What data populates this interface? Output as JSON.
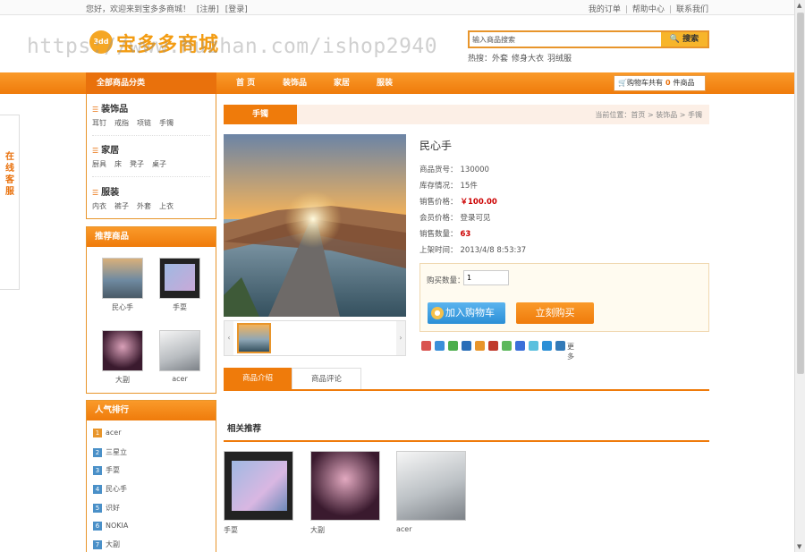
{
  "topbar": {
    "welcome": "您好，欢迎来到宝多多商城！",
    "register": "[注册]",
    "login": "[登录]",
    "links": [
      "我的订单",
      "帮助中心",
      "联系我们"
    ]
  },
  "logo": {
    "badge": "3dd",
    "text": "宝多多商城"
  },
  "watermark": "https://www.huzhan.com/ishop2940",
  "search": {
    "placeholder": "输入商品搜索",
    "button": "搜索"
  },
  "hot": {
    "label": "热搜：",
    "terms": [
      "外套",
      "修身大衣",
      "羽绒服"
    ]
  },
  "nav": {
    "all_categories": "全部商品分类",
    "items": [
      "首 页",
      "装饰品",
      "家居",
      "服装"
    ],
    "cart_prefix": "购物车共有",
    "cart_count": "0",
    "cart_suffix": "件商品"
  },
  "service_tab": "在线客服",
  "categories": [
    {
      "name": "装饰品",
      "subs": [
        "耳钉",
        "戒指",
        "项链",
        "手镯"
      ]
    },
    {
      "name": "家居",
      "subs": [
        "厨具",
        "床",
        "凳子",
        "桌子"
      ]
    },
    {
      "name": "服装",
      "subs": [
        "内衣",
        "裤子",
        "外套",
        "上衣"
      ]
    }
  ],
  "recommended": {
    "title": "推荐商品",
    "items": [
      {
        "label": "民心手",
        "icon": "landscape-photo"
      },
      {
        "label": "手耍",
        "icon": "tablet-photo"
      },
      {
        "label": "大副",
        "icon": "portrait-photo"
      },
      {
        "label": "acer",
        "icon": "snow-tree-photo"
      }
    ]
  },
  "popular": {
    "title": "人气排行",
    "items": [
      {
        "rank": "1",
        "label": "acer"
      },
      {
        "rank": "2",
        "label": "三星立"
      },
      {
        "rank": "3",
        "label": "手耍"
      },
      {
        "rank": "4",
        "label": "民心手"
      },
      {
        "rank": "5",
        "label": "识好"
      },
      {
        "rank": "6",
        "label": "NOKIA"
      },
      {
        "rank": "7",
        "label": "大副"
      }
    ]
  },
  "breadcrumb": {
    "tab": "手镯",
    "text": "当前位置：首页 > 装饰品 > 手镯"
  },
  "product": {
    "name": "民心手",
    "attrs": [
      {
        "label": "商品货号：",
        "value": "130000"
      },
      {
        "label": "库存情况：",
        "value": "15件"
      },
      {
        "label": "销售价格：",
        "value": "￥100.00"
      },
      {
        "label": "会员价格：",
        "value": "登录可见"
      },
      {
        "label": "销售数量：",
        "value": "63"
      },
      {
        "label": "上架时间：",
        "value": "2013/4/8 8:53:37"
      }
    ],
    "qty_label": "购买数量：",
    "qty_value": "1",
    "add_cart": "加入购物车",
    "buy_now": "立刻购买",
    "share_more": "更多"
  },
  "info_tabs": [
    "商品介绍",
    "商品评论"
  ],
  "related": {
    "title": "相关推荐",
    "items": [
      {
        "label": "手耍",
        "icon": "tablet-photo"
      },
      {
        "label": "大副",
        "icon": "portrait-photo"
      },
      {
        "label": "acer",
        "icon": "snow-tree-photo"
      }
    ]
  },
  "colors": {
    "accent": "#ef7b0b",
    "blue_button": "#2b8fd6",
    "price": "#cc0000"
  }
}
